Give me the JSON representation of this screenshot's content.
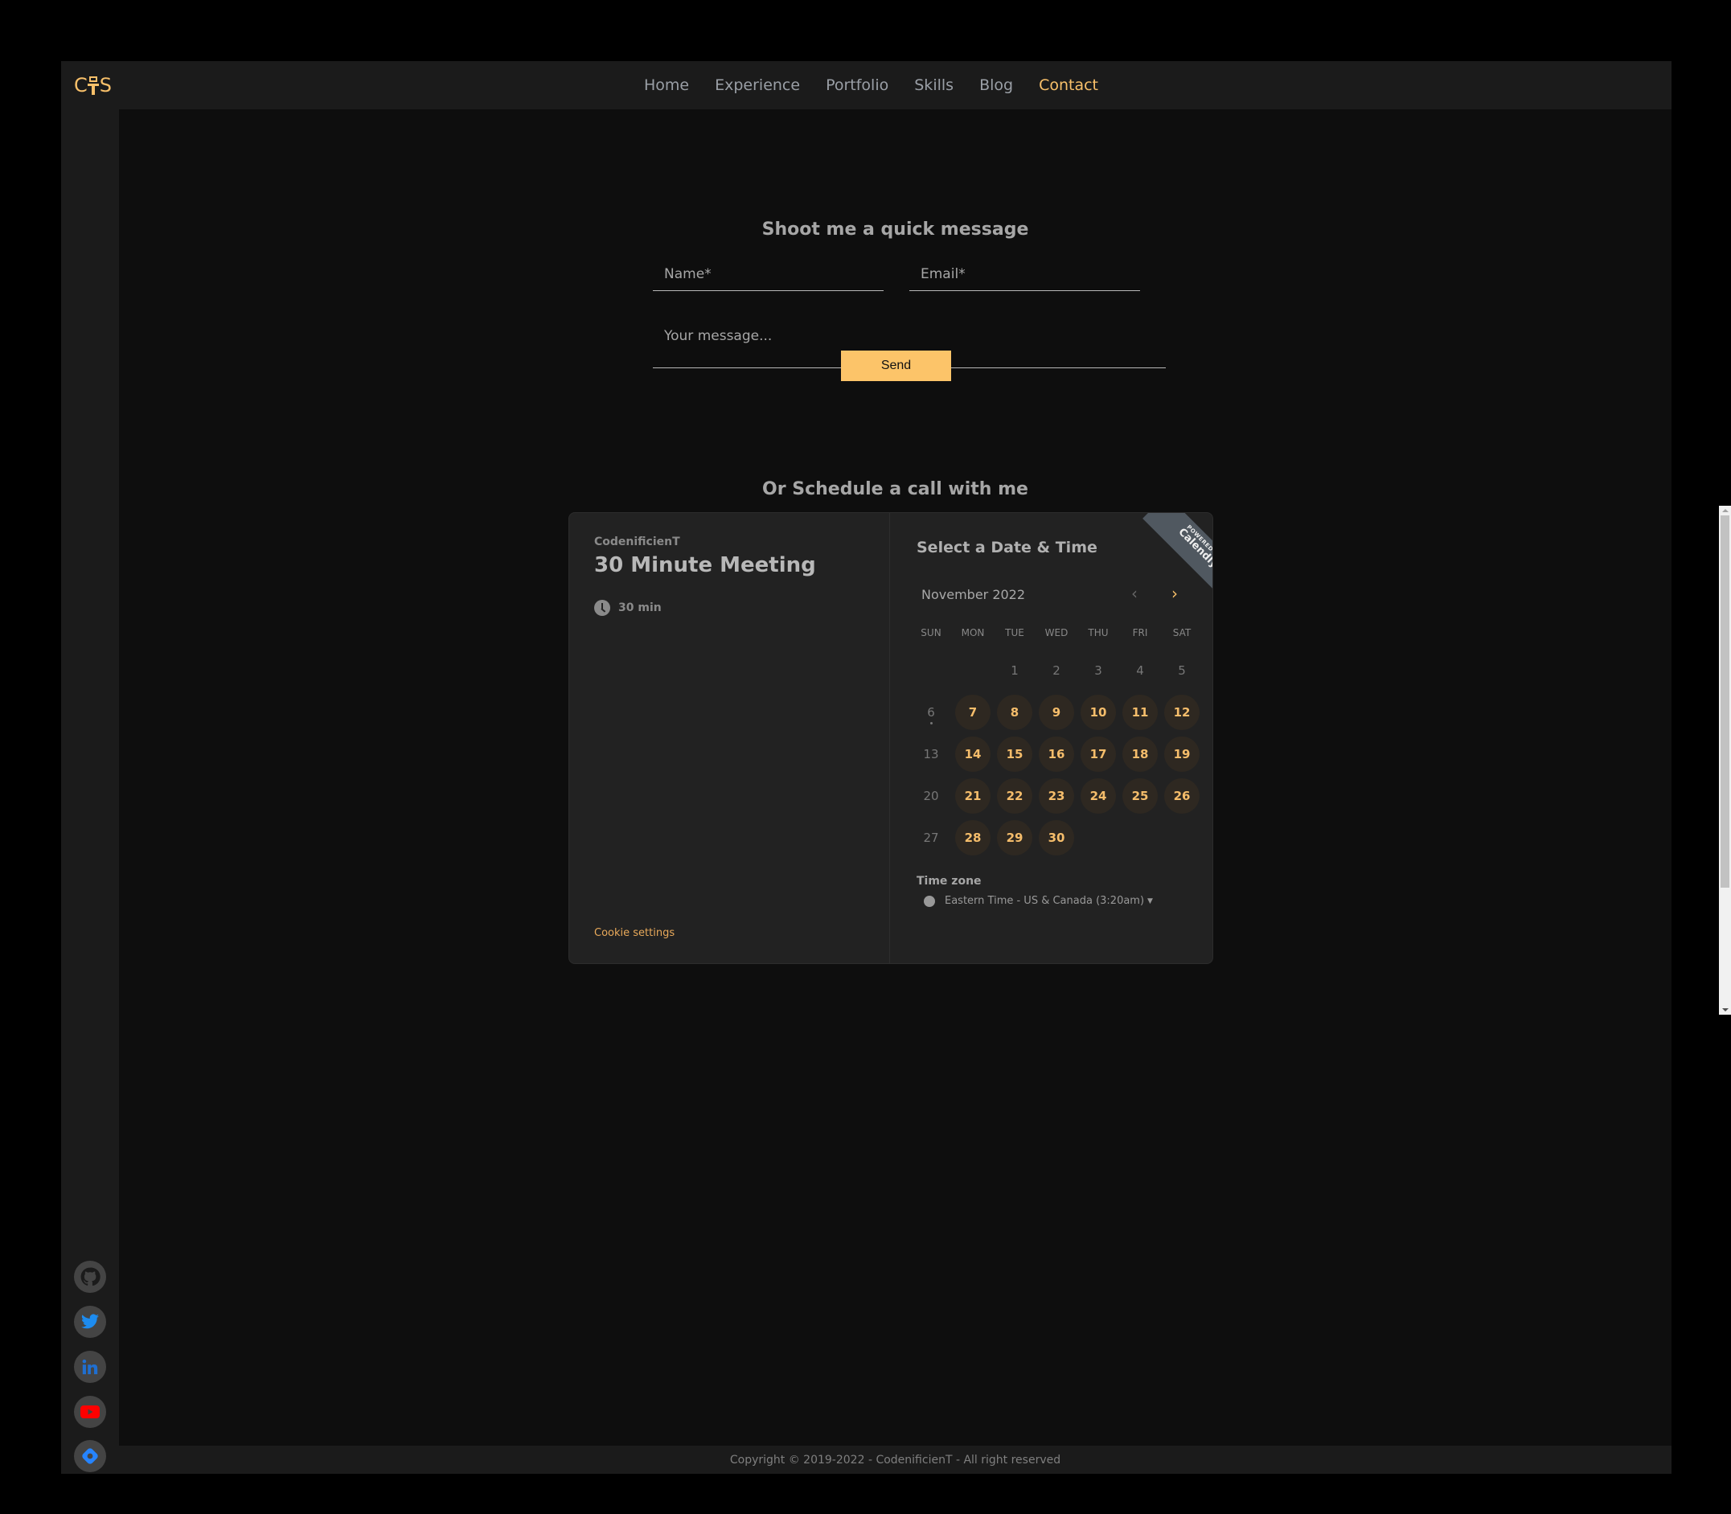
{
  "header": {
    "logo_text": [
      "C",
      "S"
    ],
    "nav": [
      {
        "label": "Home",
        "active": false
      },
      {
        "label": "Experience",
        "active": false
      },
      {
        "label": "Portfolio",
        "active": false
      },
      {
        "label": "Skills",
        "active": false
      },
      {
        "label": "Blog",
        "active": false
      },
      {
        "label": "Contact",
        "active": true
      }
    ]
  },
  "form": {
    "title": "Shoot me a quick message",
    "name_placeholder": "Name*",
    "email_placeholder": "Email*",
    "message_placeholder": "Your message...",
    "send_label": "Send"
  },
  "schedule": {
    "title": "Or Schedule a call with me"
  },
  "calendly": {
    "organizer": "CodenificienT",
    "event_title": "30 Minute Meeting",
    "duration": "30 min",
    "cookie_label": "Cookie settings",
    "select_title": "Select a Date & Time",
    "month": "November 2022",
    "prev_icon": "chevron-left-icon",
    "next_icon": "chevron-right-icon",
    "ribbon_small": "POWERED BY",
    "ribbon_brand": "Calendly",
    "weekdays": [
      "SUN",
      "MON",
      "TUE",
      "WED",
      "THU",
      "FRI",
      "SAT"
    ],
    "leading_blanks": 2,
    "days": [
      {
        "d": "1",
        "available": false
      },
      {
        "d": "2",
        "available": false
      },
      {
        "d": "3",
        "available": false
      },
      {
        "d": "4",
        "available": false
      },
      {
        "d": "5",
        "available": false
      },
      {
        "d": "6",
        "available": false,
        "today": true
      },
      {
        "d": "7",
        "available": true
      },
      {
        "d": "8",
        "available": true
      },
      {
        "d": "9",
        "available": true
      },
      {
        "d": "10",
        "available": true
      },
      {
        "d": "11",
        "available": true
      },
      {
        "d": "12",
        "available": true
      },
      {
        "d": "13",
        "available": false
      },
      {
        "d": "14",
        "available": true
      },
      {
        "d": "15",
        "available": true
      },
      {
        "d": "16",
        "available": true
      },
      {
        "d": "17",
        "available": true
      },
      {
        "d": "18",
        "available": true
      },
      {
        "d": "19",
        "available": true
      },
      {
        "d": "20",
        "available": false
      },
      {
        "d": "21",
        "available": true
      },
      {
        "d": "22",
        "available": true
      },
      {
        "d": "23",
        "available": true
      },
      {
        "d": "24",
        "available": true
      },
      {
        "d": "25",
        "available": true
      },
      {
        "d": "26",
        "available": true
      },
      {
        "d": "27",
        "available": false
      },
      {
        "d": "28",
        "available": true
      },
      {
        "d": "29",
        "available": true
      },
      {
        "d": "30",
        "available": true
      }
    ],
    "timezone_label": "Time zone",
    "timezone_value": "Eastern Time - US & Canada (3:20am)"
  },
  "social": [
    {
      "name": "github-icon",
      "color": "#1b1b1b"
    },
    {
      "name": "twitter-icon",
      "color": "#1d8cf0"
    },
    {
      "name": "linkedin-icon",
      "color": "#1f6fd1"
    },
    {
      "name": "youtube-icon",
      "color": "#ff0000"
    },
    {
      "name": "jira-icon",
      "color": "#2684ff"
    }
  ],
  "footer": {
    "text": "Copyright © 2019-2022 - CodenificienT - All right reserved"
  },
  "colors": {
    "accent": "#fcc469",
    "background": "#0e0e0e",
    "panel": "#1b1b1b"
  }
}
